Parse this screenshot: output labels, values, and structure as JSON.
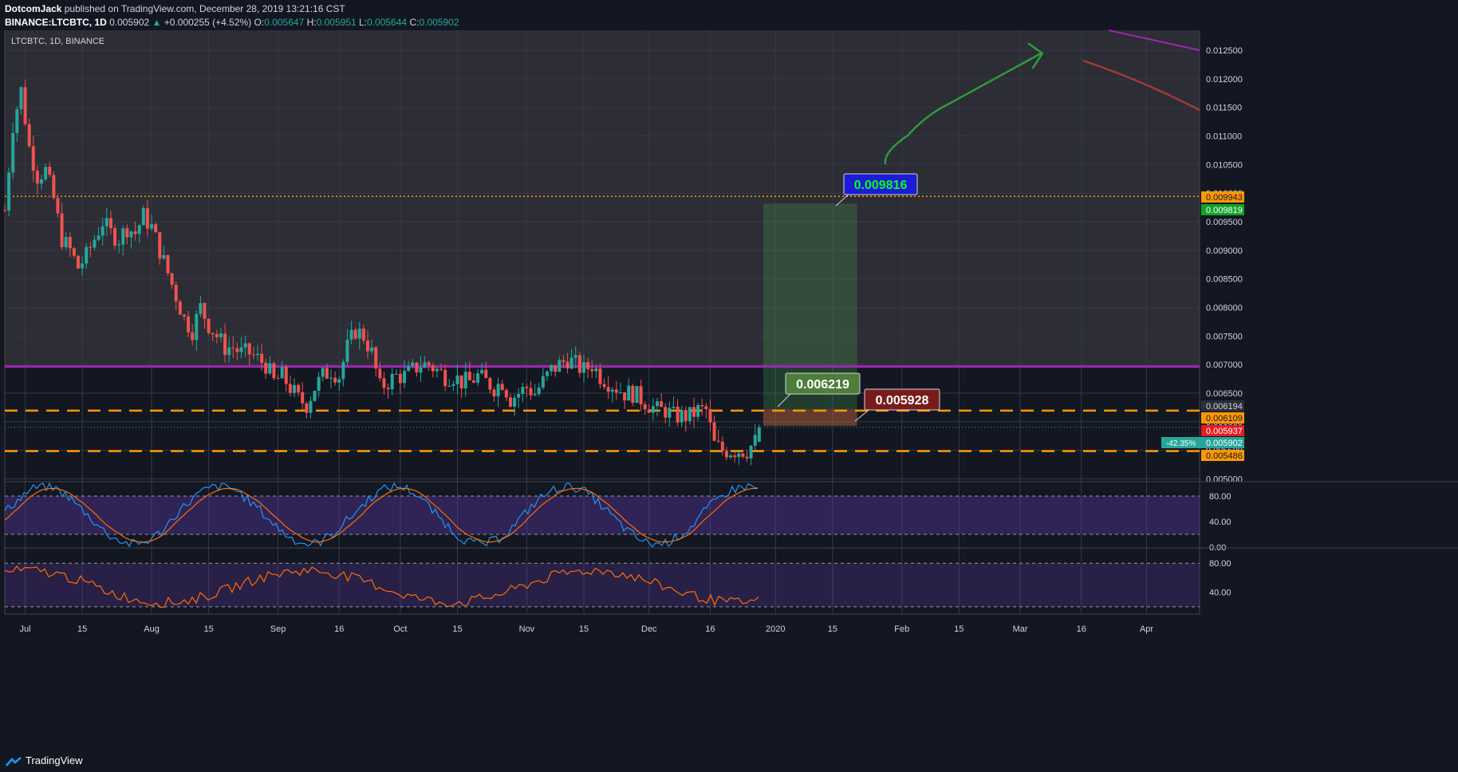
{
  "header": {
    "publisher": "DotcomJack",
    "published_text": "published on TradingView.com, December 28, 2019 13:21:16 CST",
    "symbol": "BINANCE:LTCBTC, 1D",
    "last": "0.005902",
    "change": "+0.000255 (+4.52%)",
    "o_label": "O:",
    "o_val": "0.005647",
    "h_label": "H:",
    "h_val": "0.005951",
    "l_label": "L:",
    "l_val": "0.005644",
    "c_label": "C:",
    "c_val": "0.005902"
  },
  "footer": {
    "brand": "TradingView"
  },
  "chart_data": {
    "type": "candlestick",
    "title": "LTCBTC, 1D, BINANCE",
    "price_axis": {
      "ticks": [
        "0.012500",
        "0.012000",
        "0.011500",
        "0.011000",
        "0.010500",
        "0.010000",
        "0.009500",
        "0.009000",
        "0.008500",
        "0.008000",
        "0.007500",
        "0.007000",
        "0.006500",
        "0.006000",
        "0.005500",
        "0.005000"
      ],
      "ylim": [
        0.00495,
        0.01285
      ]
    },
    "time_axis": {
      "labels": [
        "Jul",
        "15",
        "Aug",
        "15",
        "Sep",
        "16",
        "Oct",
        "15",
        "Nov",
        "15",
        "Dec",
        "16",
        "2020",
        "15",
        "Feb",
        "15",
        "Mar",
        "16",
        "Apr"
      ],
      "dates": [
        "2019-07-01",
        "2019-07-15",
        "2019-08-01",
        "2019-08-15",
        "2019-09-01",
        "2019-09-16",
        "2019-10-01",
        "2019-10-15",
        "2019-11-01",
        "2019-11-15",
        "2019-12-01",
        "2019-12-16",
        "2020-01-01",
        "2020-01-15",
        "2020-02-01",
        "2020-02-15",
        "2020-03-01",
        "2020-03-16",
        "2020-04-01"
      ]
    },
    "close_path": [
      [
        "2019-06-26",
        0.0097
      ],
      [
        "2019-06-28",
        0.0112
      ],
      [
        "2019-06-30",
        0.0118
      ],
      [
        "2019-07-02",
        0.0108
      ],
      [
        "2019-07-04",
        0.0103
      ],
      [
        "2019-07-06",
        0.0104
      ],
      [
        "2019-07-08",
        0.0099
      ],
      [
        "2019-07-10",
        0.0092
      ],
      [
        "2019-07-12",
        0.009
      ],
      [
        "2019-07-14",
        0.0087
      ],
      [
        "2019-07-16",
        0.0089
      ],
      [
        "2019-07-18",
        0.0092
      ],
      [
        "2019-07-20",
        0.0095
      ],
      [
        "2019-07-22",
        0.0093
      ],
      [
        "2019-07-24",
        0.0092
      ],
      [
        "2019-07-26",
        0.0094
      ],
      [
        "2019-07-28",
        0.0093
      ],
      [
        "2019-07-30",
        0.0096
      ],
      [
        "2019-08-01",
        0.0094
      ],
      [
        "2019-08-03",
        0.009
      ],
      [
        "2019-08-05",
        0.0086
      ],
      [
        "2019-08-07",
        0.0082
      ],
      [
        "2019-08-09",
        0.0078
      ],
      [
        "2019-08-11",
        0.0076
      ],
      [
        "2019-08-13",
        0.008
      ],
      [
        "2019-08-15",
        0.0077
      ],
      [
        "2019-08-17",
        0.0075
      ],
      [
        "2019-08-19",
        0.0073
      ],
      [
        "2019-08-21",
        0.0073
      ],
      [
        "2019-08-23",
        0.0072
      ],
      [
        "2019-08-25",
        0.0072
      ],
      [
        "2019-08-27",
        0.0071
      ],
      [
        "2019-08-29",
        0.007
      ],
      [
        "2019-08-31",
        0.0067
      ],
      [
        "2019-09-02",
        0.0068
      ],
      [
        "2019-09-04",
        0.0066
      ],
      [
        "2019-09-06",
        0.0064
      ],
      [
        "2019-09-08",
        0.0063
      ],
      [
        "2019-09-10",
        0.0066
      ],
      [
        "2019-09-12",
        0.0068
      ],
      [
        "2019-09-14",
        0.0069
      ],
      [
        "2019-09-16",
        0.0068
      ],
      [
        "2019-09-18",
        0.0073
      ],
      [
        "2019-09-20",
        0.0076
      ],
      [
        "2019-09-22",
        0.0075
      ],
      [
        "2019-09-24",
        0.0072
      ],
      [
        "2019-09-26",
        0.0066
      ],
      [
        "2019-09-28",
        0.0067
      ],
      [
        "2019-09-30",
        0.0068
      ],
      [
        "2019-10-02",
        0.0068
      ],
      [
        "2019-10-04",
        0.0069
      ],
      [
        "2019-10-06",
        0.007
      ],
      [
        "2019-10-08",
        0.007
      ],
      [
        "2019-10-10",
        0.0069
      ],
      [
        "2019-10-12",
        0.0068
      ],
      [
        "2019-10-14",
        0.0068
      ],
      [
        "2019-10-16",
        0.0067
      ],
      [
        "2019-10-18",
        0.0067
      ],
      [
        "2019-10-20",
        0.0068
      ],
      [
        "2019-10-22",
        0.0067
      ],
      [
        "2019-10-24",
        0.0066
      ],
      [
        "2019-10-26",
        0.0067
      ],
      [
        "2019-10-28",
        0.0064
      ],
      [
        "2019-10-30",
        0.0065
      ],
      [
        "2019-11-01",
        0.0066
      ],
      [
        "2019-11-03",
        0.0065
      ],
      [
        "2019-11-05",
        0.0067
      ],
      [
        "2019-11-07",
        0.0069
      ],
      [
        "2019-11-09",
        0.007
      ],
      [
        "2019-11-11",
        0.0071
      ],
      [
        "2019-11-13",
        0.007
      ],
      [
        "2019-11-15",
        0.0069
      ],
      [
        "2019-11-17",
        0.007
      ],
      [
        "2019-11-19",
        0.0068
      ],
      [
        "2019-11-21",
        0.0067
      ],
      [
        "2019-11-23",
        0.0066
      ],
      [
        "2019-11-25",
        0.0065
      ],
      [
        "2019-11-27",
        0.0065
      ],
      [
        "2019-11-29",
        0.0064
      ],
      [
        "2019-12-01",
        0.0063
      ],
      [
        "2019-12-03",
        0.0062
      ],
      [
        "2019-12-05",
        0.0062
      ],
      [
        "2019-12-07",
        0.0061
      ],
      [
        "2019-12-09",
        0.0061
      ],
      [
        "2019-12-11",
        0.0061
      ],
      [
        "2019-12-13",
        0.0062
      ],
      [
        "2019-12-15",
        0.0062
      ],
      [
        "2019-12-17",
        0.0056
      ],
      [
        "2019-12-19",
        0.0055
      ],
      [
        "2019-12-21",
        0.0055
      ],
      [
        "2019-12-23",
        0.0055
      ],
      [
        "2019-12-25",
        0.0055
      ],
      [
        "2019-12-27",
        0.00565
      ],
      [
        "2019-12-28",
        0.005902
      ]
    ],
    "horizontal_lines": [
      {
        "price": 0.009943,
        "style": "dotted",
        "color": "#ff9800"
      },
      {
        "price": 0.006194,
        "style": "dashed",
        "color": "#ff9800"
      },
      {
        "price": 0.005486,
        "style": "dashed",
        "color": "#ff9800"
      },
      {
        "price": 0.006966,
        "style": "solid",
        "color": "#9c27b0"
      }
    ],
    "position_tool": {
      "entry": 0.005928,
      "target": 0.009816,
      "stop": 0.006219,
      "start": "2019-12-29",
      "end": "2020-01-21"
    },
    "callouts": [
      {
        "text": "0.009816",
        "color": "#00ff26",
        "bg": "#1c1cd4"
      },
      {
        "text": "0.006219",
        "color": "#ffffff",
        "bg": "#4e7d3c"
      },
      {
        "text": "0.005928",
        "color": "#ffffff",
        "bg": "#7a1b1b"
      }
    ],
    "price_labels": [
      {
        "text": "0.009943",
        "bg": "#ff9800",
        "color": "#131722"
      },
      {
        "text": "0.009819",
        "bg": "#11a32b",
        "color": "#ffffff"
      },
      {
        "text": "0.006194",
        "bg": "#2a2e39",
        "color": "#d1d4dc"
      },
      {
        "text": "0.006109",
        "bg": "#ff9800",
        "color": "#131722"
      },
      {
        "text": "0.005937",
        "bg": "#e51c23",
        "color": "#ffffff"
      },
      {
        "text": "0.005902",
        "bg": "#26a69a",
        "color": "#ffffff"
      },
      {
        "text": "0.005486",
        "bg": "#ff9800",
        "color": "#131722"
      }
    ],
    "pct_label": "-42.35%",
    "stoch": {
      "ticks": [
        "80.00",
        "40.00",
        "0.00"
      ],
      "ylim": [
        0,
        100
      ],
      "levels": [
        80,
        20
      ]
    },
    "osc2": {
      "ticks": [
        "80.00",
        "40.00"
      ],
      "ylim": [
        10,
        100
      ],
      "levels": [
        80,
        20
      ]
    }
  }
}
